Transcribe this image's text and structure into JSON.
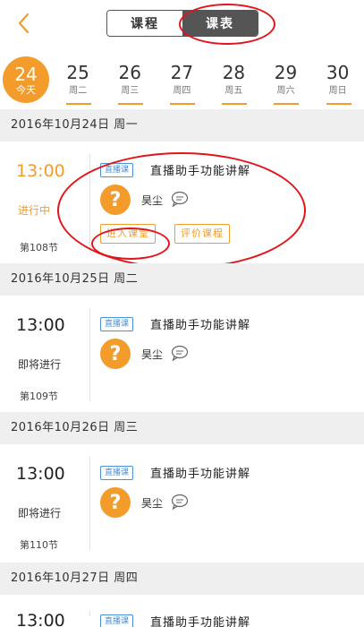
{
  "header": {
    "tabs": [
      {
        "label": "课程",
        "active": false
      },
      {
        "label": "课表",
        "active": true
      }
    ]
  },
  "date_strip": {
    "days": [
      {
        "num": "24",
        "label": "今天",
        "today": true
      },
      {
        "num": "25",
        "label": "周二"
      },
      {
        "num": "26",
        "label": "周三"
      },
      {
        "num": "27",
        "label": "周四"
      },
      {
        "num": "28",
        "label": "周五"
      },
      {
        "num": "29",
        "label": "周六"
      },
      {
        "num": "30",
        "label": "周日"
      }
    ]
  },
  "schedule": [
    {
      "date_header": "2016年10月24日 周一",
      "time": "13:00",
      "status": "进行中",
      "lesson": "第108节",
      "badge": "直播课",
      "title": "直播助手功能讲解",
      "teacher": "昊尘",
      "buttons": [
        "进入课堂",
        "评价课程"
      ]
    },
    {
      "date_header": "2016年10月25日 周二",
      "time": "13:00",
      "status": "即将进行",
      "lesson": "第109节",
      "badge": "直播课",
      "title": "直播助手功能讲解",
      "teacher": "昊尘"
    },
    {
      "date_header": "2016年10月26日 周三",
      "time": "13:00",
      "status": "即将进行",
      "lesson": "第110节",
      "badge": "直播课",
      "title": "直播助手功能讲解",
      "teacher": "昊尘"
    },
    {
      "date_header": "2016年10月27日 周四",
      "time": "13:00",
      "badge": "直播课",
      "title": "直播助手功能讲解"
    }
  ],
  "colors": {
    "accent": "#f39c2c",
    "badge": "#4a90d9",
    "annotation": "#e3151a"
  }
}
